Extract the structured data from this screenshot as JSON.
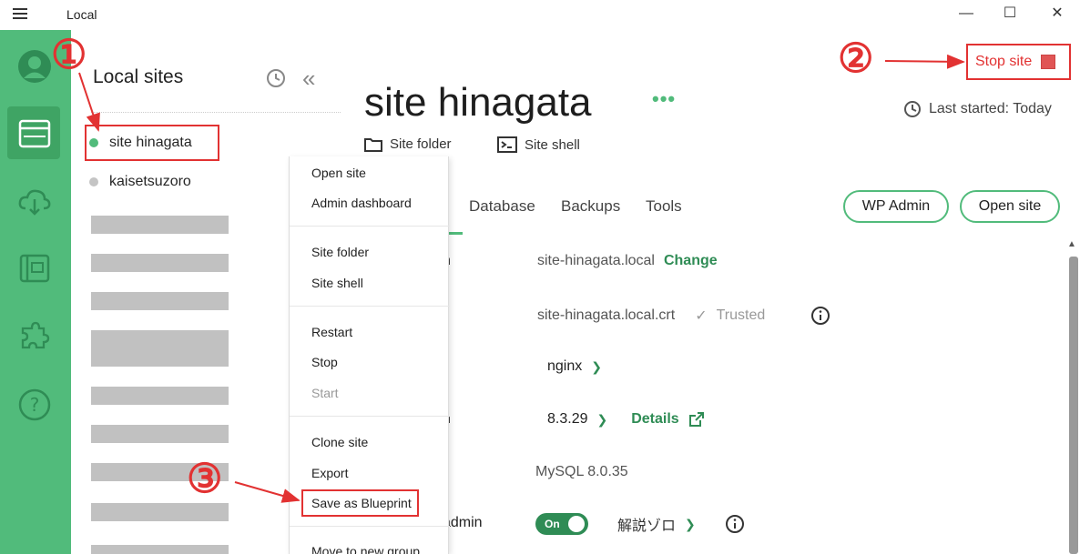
{
  "window": {
    "title": "Local",
    "minimize": "—",
    "maximize": "☐",
    "close": "✕"
  },
  "sidebar": {
    "title": "Local sites",
    "sites": [
      {
        "name": "site hinagata",
        "status": "running",
        "color": "#51bb7b"
      },
      {
        "name": "kaisetsuzoro",
        "status": "stopped",
        "color": "#bbbbbb"
      }
    ]
  },
  "site": {
    "name": "site hinagata",
    "more": "•••",
    "stop_label": "Stop site",
    "last_started": "Last started: Today",
    "site_folder": "Site folder",
    "site_shell": "Site shell"
  },
  "tabs": [
    "Database",
    "Backups",
    "Tools"
  ],
  "buttons": {
    "wp_admin": "WP Admin",
    "open_site": "Open site"
  },
  "details": {
    "domain_label_tail": "n",
    "domain_value": "site-hinagata.local",
    "domain_change": "Change",
    "ssl_value": "site-hinagata.local.crt",
    "ssl_trusted": "Trusted",
    "server_label_tail": "r",
    "server_value": "nginx",
    "php_label_tail": "n",
    "php_value": "8.3.29",
    "php_details": "Details",
    "db_value": "MySQL 8.0.35",
    "admin_label_tail": "admin",
    "admin_toggle": "On",
    "admin_user": "解説ゾロ"
  },
  "context_menu": {
    "items": [
      {
        "label": "Open site",
        "disabled": false
      },
      {
        "label": "Admin dashboard",
        "disabled": false
      },
      {
        "label": "Site folder",
        "disabled": false
      },
      {
        "label": "Site shell",
        "disabled": false
      },
      {
        "label": "Restart",
        "disabled": false
      },
      {
        "label": "Stop",
        "disabled": false
      },
      {
        "label": "Start",
        "disabled": true
      },
      {
        "label": "Clone site",
        "disabled": false
      },
      {
        "label": "Export",
        "disabled": false
      },
      {
        "label": "Save as Blueprint",
        "disabled": false
      },
      {
        "label": "Move to new group",
        "disabled": false
      }
    ]
  },
  "annotations": {
    "num1": "①",
    "num2": "②",
    "num3": "③",
    "color": "#e23232"
  },
  "colors": {
    "brand_green": "#51bb7b",
    "dark_green": "#2f8c55"
  }
}
